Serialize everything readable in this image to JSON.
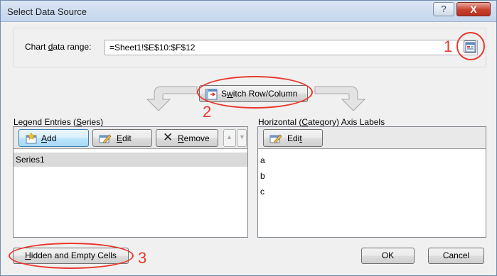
{
  "window": {
    "title": "Select Data Source",
    "help_label": "?",
    "close_label": "X"
  },
  "range": {
    "label_pre": "Chart ",
    "label_underline": "d",
    "label_post": "ata range:",
    "value": "=Sheet1!$E$10:$F$12"
  },
  "switch_button": {
    "pre": "S",
    "underline": "w",
    "post": "itch Row/Column"
  },
  "legend_pane": {
    "title_pre": "Legend Entries (",
    "title_underline": "S",
    "title_post": "eries)",
    "add_label": "Add",
    "add_underline": "A",
    "edit_label": "dit",
    "edit_underline": "E",
    "remove_pre": "",
    "remove_underline": "R",
    "remove_post": "emove",
    "up_label": "▲",
    "down_label": "▼",
    "items": [
      "Series1"
    ]
  },
  "axis_pane": {
    "title_pre": "Horizontal (",
    "title_underline": "C",
    "title_post": "ategory) Axis Labels",
    "edit_pre": "Edi",
    "edit_underline": "t",
    "items": [
      "a",
      "b",
      "c"
    ]
  },
  "footer": {
    "hidden_underline": "H",
    "hidden_post": "idden and Empty Cells",
    "ok_label": "OK",
    "cancel_label": "Cancel"
  },
  "annotations": {
    "one": "1",
    "two": "2",
    "three": "3"
  },
  "colors": {
    "annotation_red": "#e8382c",
    "titlebar": "#c4d5ec",
    "close_button": "#c7412c"
  }
}
